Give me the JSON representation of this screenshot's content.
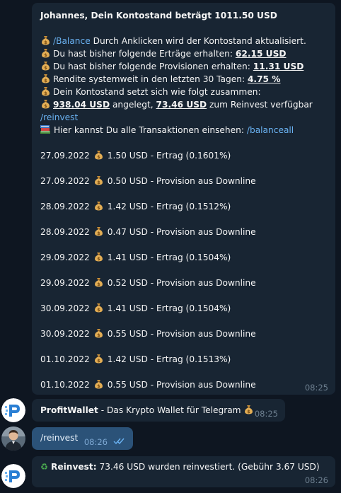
{
  "message1": {
    "header": "Johannes, Dein Kontostand beträgt 1011.50 USD",
    "balance_link": "/Balance",
    "balance_text": " Durch Anklicken wird der Kontostand aktualisiert.",
    "earnings_text": "Du hast bisher folgende Erträge erhalten: ",
    "earnings_value": "62.15 USD",
    "commissions_text": "Du hast bisher folgende Provisionen erhalten: ",
    "commissions_value": "11.31 USD",
    "yield_text": "Rendite systemweit in den letzten 30 Tagen: ",
    "yield_value": "4.75 %",
    "composition_text": "Dein Kontostand setzt sich wie folgt zusammen:",
    "invested_value": "938.04 USD",
    "invested_text": " angelegt, ",
    "reinvest_value": "73.46 USD",
    "reinvest_text": " zum Reinvest verfügbar",
    "reinvest_link": "/reinvest",
    "transactions_text": "Hier kannst Du alle Transaktionen einsehen:  ",
    "balanceall_link": "/balanceall",
    "transactions": [
      {
        "date": "27.09.2022",
        "text": "1.50 USD - Ertrag (0.1601%)"
      },
      {
        "date": "27.09.2022",
        "text": "0.50 USD - Provision aus Downline"
      },
      {
        "date": "28.09.2022",
        "text": "1.42 USD - Ertrag (0.1512%)"
      },
      {
        "date": "28.09.2022",
        "text": "0.47 USD - Provision aus Downline"
      },
      {
        "date": "29.09.2022",
        "text": "1.41 USD - Ertrag (0.1504%)"
      },
      {
        "date": "29.09.2022",
        "text": "0.52 USD - Provision aus Downline"
      },
      {
        "date": "30.09.2022",
        "text": "1.41 USD - Ertrag (0.1504%)"
      },
      {
        "date": "30.09.2022",
        "text": "0.55 USD - Provision aus Downline"
      },
      {
        "date": "01.10.2022",
        "text": "1.42 USD - Ertrag (0.1513%)"
      },
      {
        "date": "01.10.2022",
        "text": "0.55 USD - Provision aus Downline"
      }
    ],
    "time": "08:25"
  },
  "message2": {
    "sender": "ProfitWallet",
    "text": " - Das Krypto Wallet für Telegram ",
    "time": "08:25"
  },
  "message3": {
    "text": "/reinvest",
    "time": "08:26"
  },
  "message4": {
    "label": "Reinvest:",
    "text": " 73.46 USD wurden reinvestiert. (Gebühr 3.67 USD)",
    "time": "08:26"
  },
  "colors": {
    "background": "#0e1621",
    "incoming_bubble": "#182533",
    "outgoing_bubble": "#2b5278",
    "link": "#6ab2f2",
    "time": "#6d7f8f"
  },
  "icons": [
    "moneybag-icon",
    "books-icon",
    "recycle-icon",
    "double-check-icon",
    "bot-avatar",
    "user-avatar"
  ]
}
